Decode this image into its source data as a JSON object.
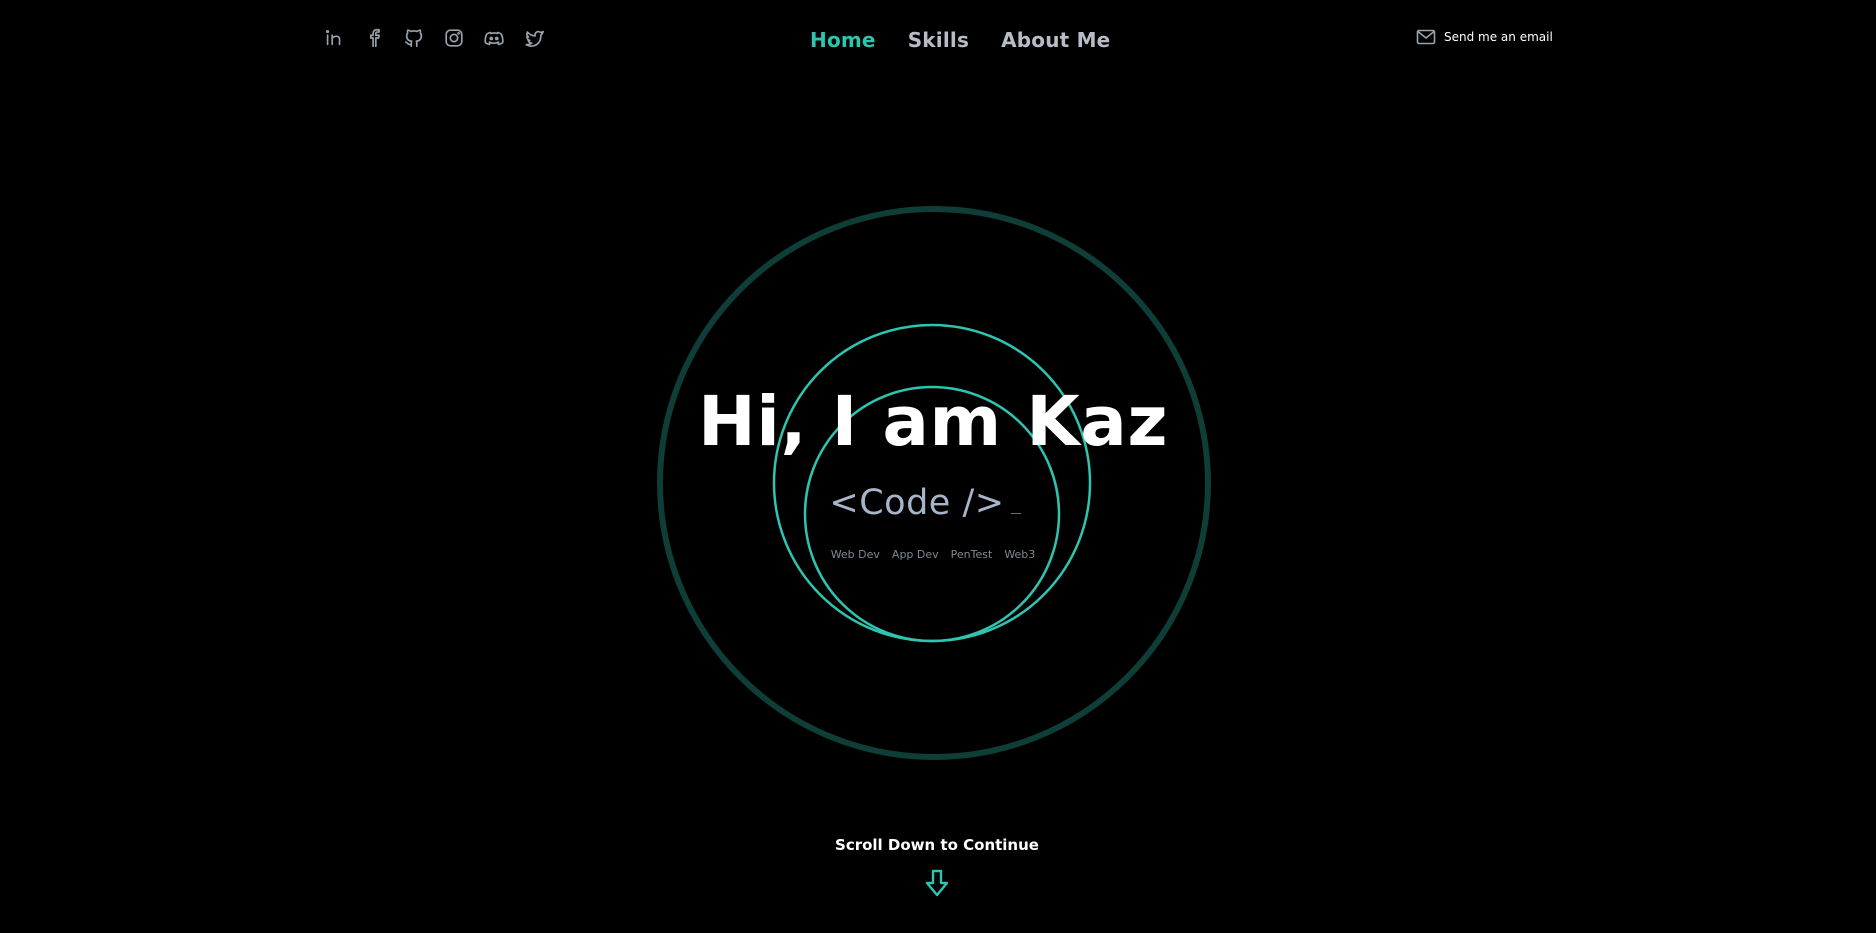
{
  "header": {
    "social_icons": [
      "linkedin-icon",
      "facebook-icon",
      "github-icon",
      "instagram-icon",
      "discord-icon",
      "twitter-icon"
    ],
    "nav": [
      {
        "label": "Home",
        "active": true
      },
      {
        "label": "Skills",
        "active": false
      },
      {
        "label": "About Me",
        "active": false
      }
    ],
    "email_label": "Send me an email",
    "email_icon": "mail-icon"
  },
  "hero": {
    "title": "Hi, I am Kaz",
    "code_text": "<Code />",
    "tags": [
      "Web Dev",
      "App Dev",
      "PenTest",
      "Web3"
    ]
  },
  "scroll": {
    "label": "Scroll Down to Continue",
    "icon": "arrow-down-icon"
  },
  "colors": {
    "background": "#000000",
    "accent": "#2ec4b0",
    "outer_ring": "#0f3d37",
    "nav_text": "#b6bdc6",
    "code_text": "#a8b4c8"
  }
}
